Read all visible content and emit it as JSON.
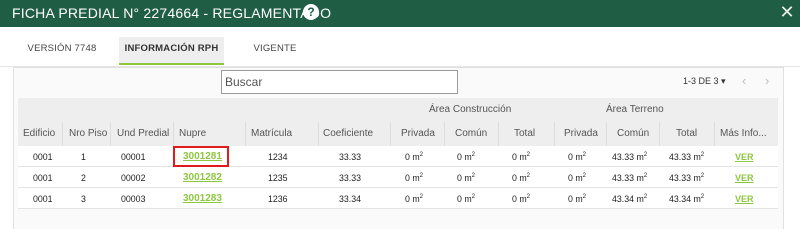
{
  "header": {
    "title": "FICHA PREDIAL N° 2274664 - REGLAMENTADO",
    "help_icon": "?",
    "close_icon": "✕"
  },
  "tabs": [
    {
      "label": "VERSIÓN 7748",
      "active": false
    },
    {
      "label": "INFORMACIÓN RPH",
      "active": true
    },
    {
      "label": "VIGENTE",
      "active": false
    }
  ],
  "search": {
    "placeholder": "Buscar",
    "value": ""
  },
  "pagination": {
    "label": "1-3 DE 3",
    "dropdown_icon": "▾",
    "prev_icon": "‹",
    "next_icon": "›"
  },
  "table": {
    "groups": {
      "construccion": "Área Construcción",
      "terreno": "Área Terreno"
    },
    "columns": [
      "Edificio",
      "Nro Piso",
      "Und Predial",
      "Nupre",
      "Matrícula",
      "Coeficiente",
      "Privada",
      "Común",
      "Total",
      "Privada",
      "Común",
      "Total",
      "Más Info..."
    ],
    "rows": [
      {
        "edificio": "0001",
        "piso": "1",
        "und": "00001",
        "nupre": "3001281",
        "matricula": "1234",
        "coef": "33.33",
        "c_priv": "0 m",
        "c_com": "0 m",
        "c_tot": "0 m",
        "t_priv": "0 m",
        "t_com": "43.33 m",
        "t_tot": "43.33 m",
        "info": "VER"
      },
      {
        "edificio": "0001",
        "piso": "2",
        "und": "00002",
        "nupre": "3001282",
        "matricula": "1235",
        "coef": "33.33",
        "c_priv": "0 m",
        "c_com": "0 m",
        "c_tot": "0 m",
        "t_priv": "0 m",
        "t_com": "43.33 m",
        "t_tot": "43.33 m",
        "info": "VER"
      },
      {
        "edificio": "0001",
        "piso": "3",
        "und": "00003",
        "nupre": "3001283",
        "matricula": "1236",
        "coef": "33.34",
        "c_priv": "0 m",
        "c_com": "0 m",
        "c_tot": "0 m",
        "t_priv": "0 m",
        "t_com": "43.34 m",
        "t_tot": "43.34 m",
        "info": "VER"
      }
    ],
    "unit_sup": "2"
  },
  "colors": {
    "header_bg": "#1f5d45",
    "accent_green": "#8dc63f",
    "highlight_red": "#e01b1b"
  }
}
